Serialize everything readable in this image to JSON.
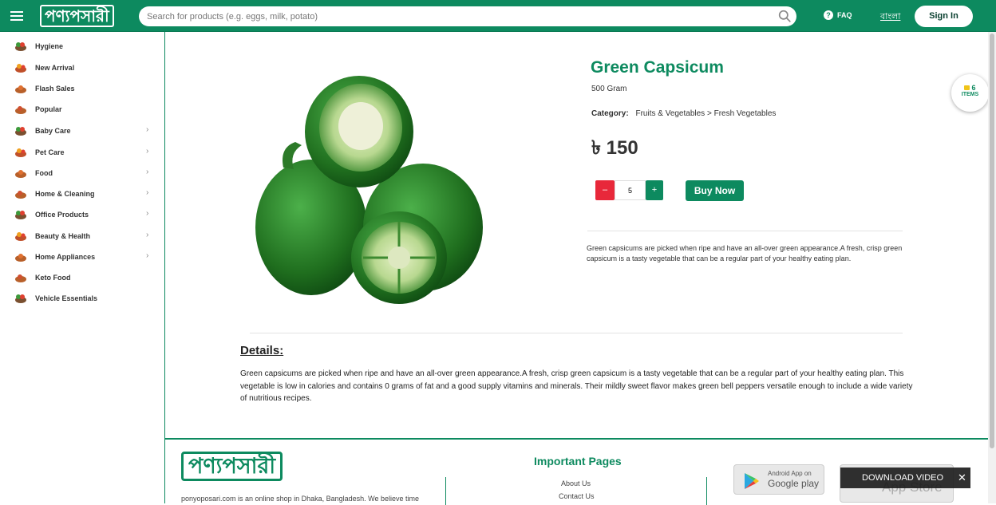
{
  "header": {
    "logo_text": "পণ্যপসারী",
    "search_placeholder": "Search for products (e.g. eggs, milk, potato)",
    "faq_label": "FAQ",
    "language_label": "বাংলা",
    "signin_label": "Sign In"
  },
  "sidebar": {
    "items": [
      {
        "label": "Hygiene",
        "has_children": false
      },
      {
        "label": "New Arrival",
        "has_children": false
      },
      {
        "label": "Flash Sales",
        "has_children": false
      },
      {
        "label": "Popular",
        "has_children": false
      },
      {
        "label": "Baby Care",
        "has_children": true
      },
      {
        "label": "Pet Care",
        "has_children": true
      },
      {
        "label": "Food",
        "has_children": true
      },
      {
        "label": "Home & Cleaning",
        "has_children": true
      },
      {
        "label": "Office Products",
        "has_children": true
      },
      {
        "label": "Beauty & Health",
        "has_children": true
      },
      {
        "label": "Home Appliances",
        "has_children": true
      },
      {
        "label": "Keto Food",
        "has_children": false
      },
      {
        "label": "Vehicle Essentials",
        "has_children": false
      }
    ]
  },
  "product": {
    "title": "Green Capsicum",
    "weight": "500 Gram",
    "category_label": "Category:",
    "category_path": "Fruits & Vegetables  >  Fresh Vegetables",
    "price": "৳ 150",
    "quantity": "5",
    "minus_label": "–",
    "plus_label": "+",
    "buy_label": "Buy Now",
    "short_description": "Green capsicums are picked when ripe and have an all-over green appearance.A fresh, crisp green capsicum is a tasty vegetable that can be a regular part of your healthy eating plan.",
    "details_heading": "Details:",
    "details_text": "Green capsicums are picked when ripe and have an all-over green appearance.A fresh, crisp green capsicum is a tasty vegetable that can be a regular part of your healthy eating plan. This vegetable is low in calories and contains 0 grams of fat and a good supply vitamins and minerals. Their mildly sweet flavor makes green bell peppers versatile enough to include a wide variety of nutritious recipes."
  },
  "cart": {
    "count": "6",
    "items_label": "ITEMS"
  },
  "footer": {
    "logo_text": "পণ্যপসারী",
    "about_text": "ponyoposari.com is an online shop in Dhaka, Bangladesh. We believe time",
    "important_pages_title": "Important Pages",
    "links": [
      "About Us",
      "Contact Us"
    ],
    "google_play_small": "Android App on",
    "google_play_big": "Google play",
    "app_store_label": "App Store",
    "download_video_label": "DOWNLOAD VIDEO",
    "download_close_label": "✕"
  },
  "colors": {
    "brand_green": "#0d8a5f",
    "minus_red": "#e8283a"
  }
}
